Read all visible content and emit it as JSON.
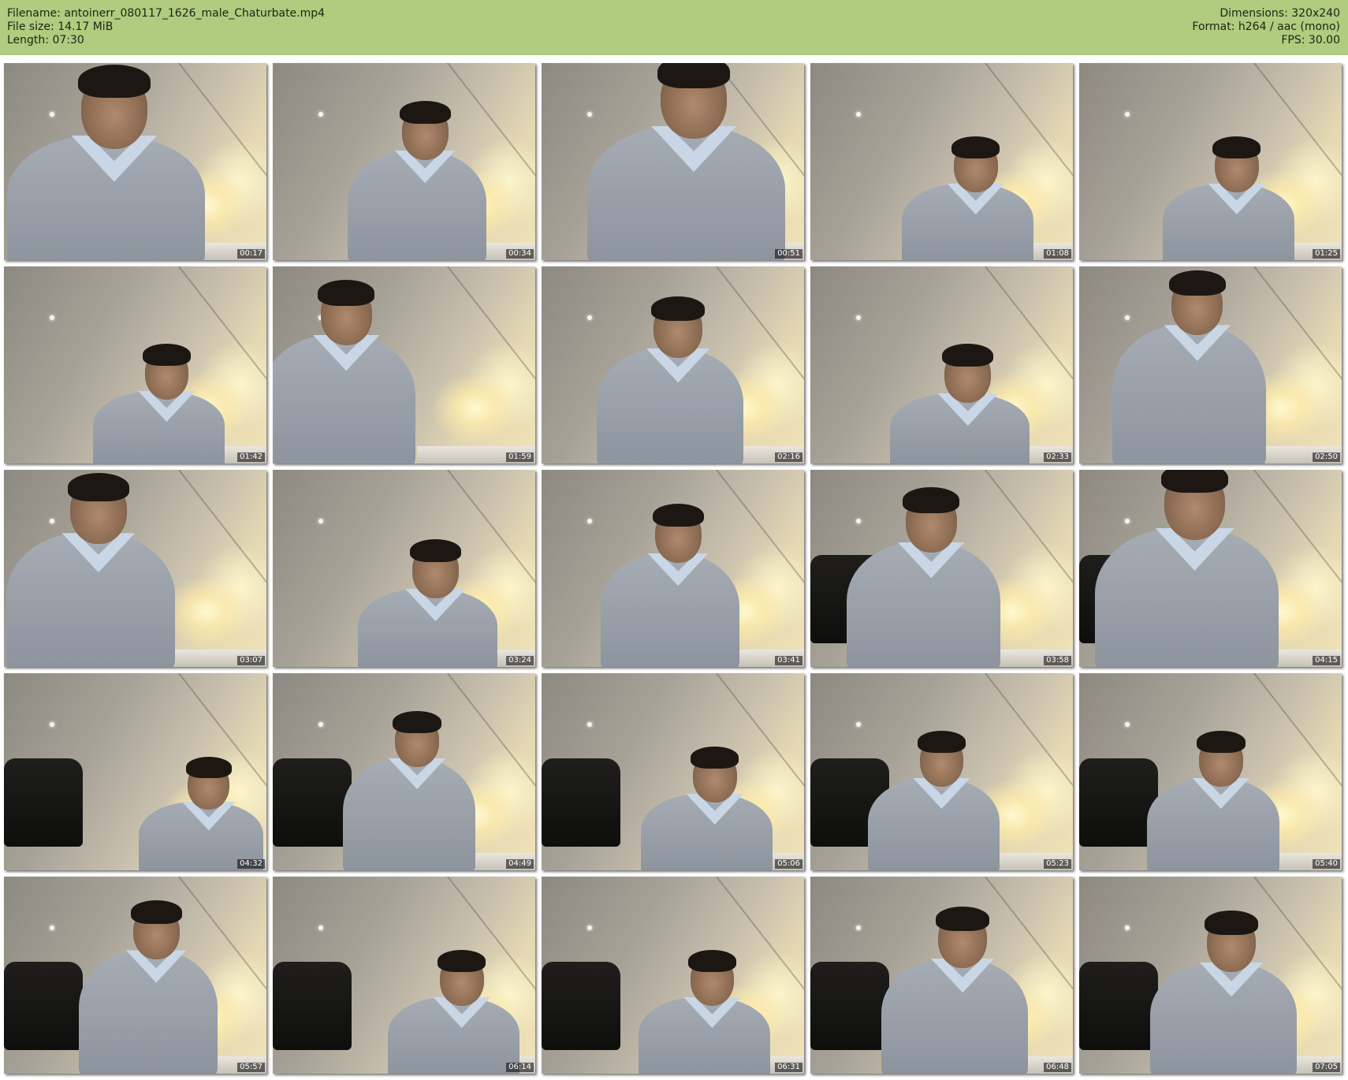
{
  "header": {
    "filename_label": "Filename:",
    "filename": "antoinerr_080117_1626_male_Chaturbate.mp4",
    "filesize_label": "File size:",
    "filesize": "14.17 MiB",
    "length_label": "Length:",
    "length": "07:30",
    "dimensions_label": "Dimensions:",
    "dimensions": "320x240",
    "format_label": "Format:",
    "format": "h264 / aac (mono)",
    "fps_label": "FPS:",
    "fps": "30.00"
  },
  "colors": {
    "header_bg": "#afcc7f",
    "page_bg": "#ffffff"
  },
  "thumbnails": [
    {
      "time": "00:17"
    },
    {
      "time": "00:34"
    },
    {
      "time": "00:51"
    },
    {
      "time": "01:08"
    },
    {
      "time": "01:25"
    },
    {
      "time": "01:42"
    },
    {
      "time": "01:59"
    },
    {
      "time": "02:16"
    },
    {
      "time": "02:33"
    },
    {
      "time": "02:50"
    },
    {
      "time": "03:07"
    },
    {
      "time": "03:24"
    },
    {
      "time": "03:41"
    },
    {
      "time": "03:58"
    },
    {
      "time": "04:15"
    },
    {
      "time": "04:32"
    },
    {
      "time": "04:49"
    },
    {
      "time": "05:06"
    },
    {
      "time": "05:23"
    },
    {
      "time": "05:40"
    },
    {
      "time": "05:57"
    },
    {
      "time": "06:14"
    },
    {
      "time": "06:31"
    },
    {
      "time": "06:48"
    },
    {
      "time": "07:05"
    }
  ]
}
